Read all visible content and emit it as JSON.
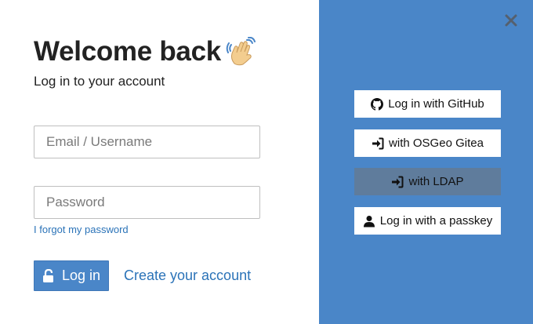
{
  "login": {
    "title": "Welcome back",
    "title_emoji": "waving-hand-emoji",
    "subtitle": "Log in to your account",
    "email_placeholder": "Email / Username",
    "password_placeholder": "Password",
    "forgot_password": "I forgot my password",
    "login_button": "Log in",
    "create_account": "Create your account"
  },
  "auth_providers": [
    {
      "label": "Log in with GitHub",
      "icon": "github-icon"
    },
    {
      "label": "with OSGeo Gitea",
      "icon": "sign-in-icon"
    },
    {
      "label": "with LDAP",
      "icon": "sign-in-icon"
    },
    {
      "label": "Log in with a passkey",
      "icon": "user-icon"
    }
  ],
  "colors": {
    "accent": "#4a86c8",
    "link": "#2b73b8",
    "ldap_button": "#5f7c9c"
  }
}
